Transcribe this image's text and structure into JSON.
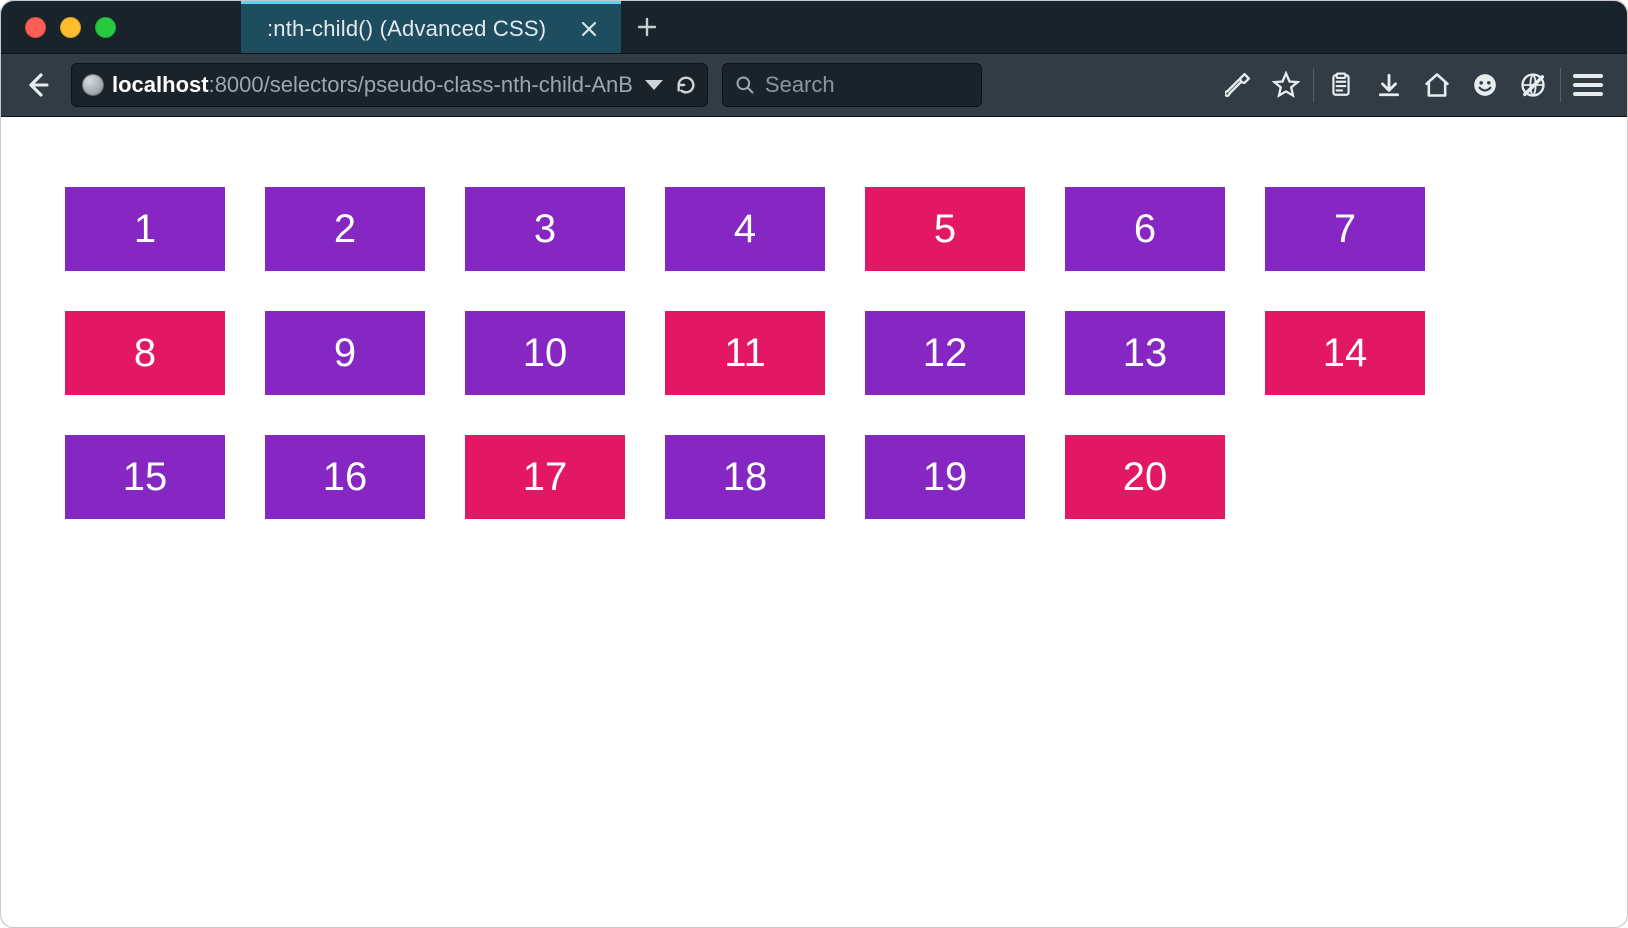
{
  "tab": {
    "title": ":nth-child() (Advanced CSS)"
  },
  "url": {
    "host": "localhost",
    "path": ":8000/selectors/pseudo-class-nth-child-AnB"
  },
  "search": {
    "placeholder": "Search"
  },
  "colors": {
    "purple": "#8626c3",
    "pink": "#e31864"
  },
  "grid": {
    "columns": 7,
    "cells": [
      {
        "n": "1",
        "hl": false
      },
      {
        "n": "2",
        "hl": false
      },
      {
        "n": "3",
        "hl": false
      },
      {
        "n": "4",
        "hl": false
      },
      {
        "n": "5",
        "hl": true
      },
      {
        "n": "6",
        "hl": false
      },
      {
        "n": "7",
        "hl": false
      },
      {
        "n": "8",
        "hl": true
      },
      {
        "n": "9",
        "hl": false
      },
      {
        "n": "10",
        "hl": false
      },
      {
        "n": "11",
        "hl": true
      },
      {
        "n": "12",
        "hl": false
      },
      {
        "n": "13",
        "hl": false
      },
      {
        "n": "14",
        "hl": true
      },
      {
        "n": "15",
        "hl": false
      },
      {
        "n": "16",
        "hl": false
      },
      {
        "n": "17",
        "hl": true
      },
      {
        "n": "18",
        "hl": false
      },
      {
        "n": "19",
        "hl": false
      },
      {
        "n": "20",
        "hl": true
      }
    ]
  }
}
